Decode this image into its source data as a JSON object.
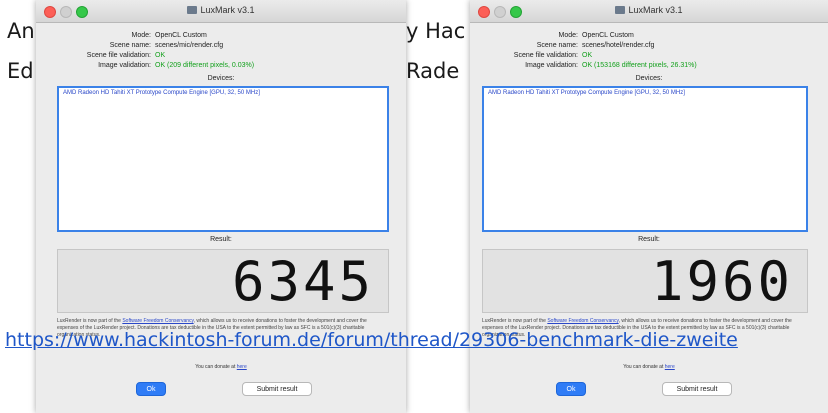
{
  "background": {
    "line1_left": "An",
    "line1_mid": "y Hac",
    "line2_left": "Ed",
    "line2_mid": "Rade",
    "link_text": "https://www.hackintosh-forum.de/forum/thread/29306-benchmark-die-zweite"
  },
  "colors": {
    "ok_green": "#13a01c",
    "link_blue": "#1e56c8",
    "selection_blue": "#3b82e8",
    "button_blue": "#2f7cf6"
  },
  "windows": [
    {
      "title": "LuxMark v3.1",
      "mode_label": "Mode:",
      "mode": "OpenCL Custom",
      "scene_label": "Scene name:",
      "scene": "scenes/mic/render.cfg",
      "scene_validation_label": "Scene file validation:",
      "scene_validation": "OK",
      "image_validation_label": "Image validation:",
      "image_validation": "OK (209 different pixels, 0.03%)",
      "devices_label": "Devices:",
      "device": "AMD Radeon HD Tahiti XT Prototype Compute Engine [GPU, 32, 50 MHz]",
      "result_label": "Result:",
      "result": "6345",
      "notice_pre": "LuxRender is now part of the ",
      "notice_link": "Software Freedom Conservancy",
      "notice_post": ", which allows us to receive donations to foster the development and cover the expenses of the LuxRender project. Donations are tax deductible in the USA to the extent permitted by law as SFC is a 501(c)(3) charitable organization status.",
      "donate_pre": "You can donate at ",
      "donate_link": "here",
      "ok_button": "Ok",
      "submit_button": "Submit result"
    },
    {
      "title": "LuxMark v3.1",
      "mode_label": "Mode:",
      "mode": "OpenCL Custom",
      "scene_label": "Scene name:",
      "scene": "scenes/hotel/render.cfg",
      "scene_validation_label": "Scene file validation:",
      "scene_validation": "OK",
      "image_validation_label": "Image validation:",
      "image_validation": "OK (153168 different pixels, 26.31%)",
      "devices_label": "Devices:",
      "device": "AMD Radeon HD Tahiti XT Prototype Compute Engine [GPU, 32, 50 MHz]",
      "result_label": "Result:",
      "result": "1960",
      "notice_pre": "LuxRender is now part of the ",
      "notice_link": "Software Freedom Conservancy",
      "notice_post": ", which allows us to receive donations to foster the development and cover the expenses of the LuxRender project. Donations are tax deductible in the USA to the extent permitted by law as SFC is a 501(c)(3) charitable organization status.",
      "donate_pre": "You can donate at ",
      "donate_link": "here",
      "ok_button": "Ok",
      "submit_button": "Submit result"
    }
  ]
}
